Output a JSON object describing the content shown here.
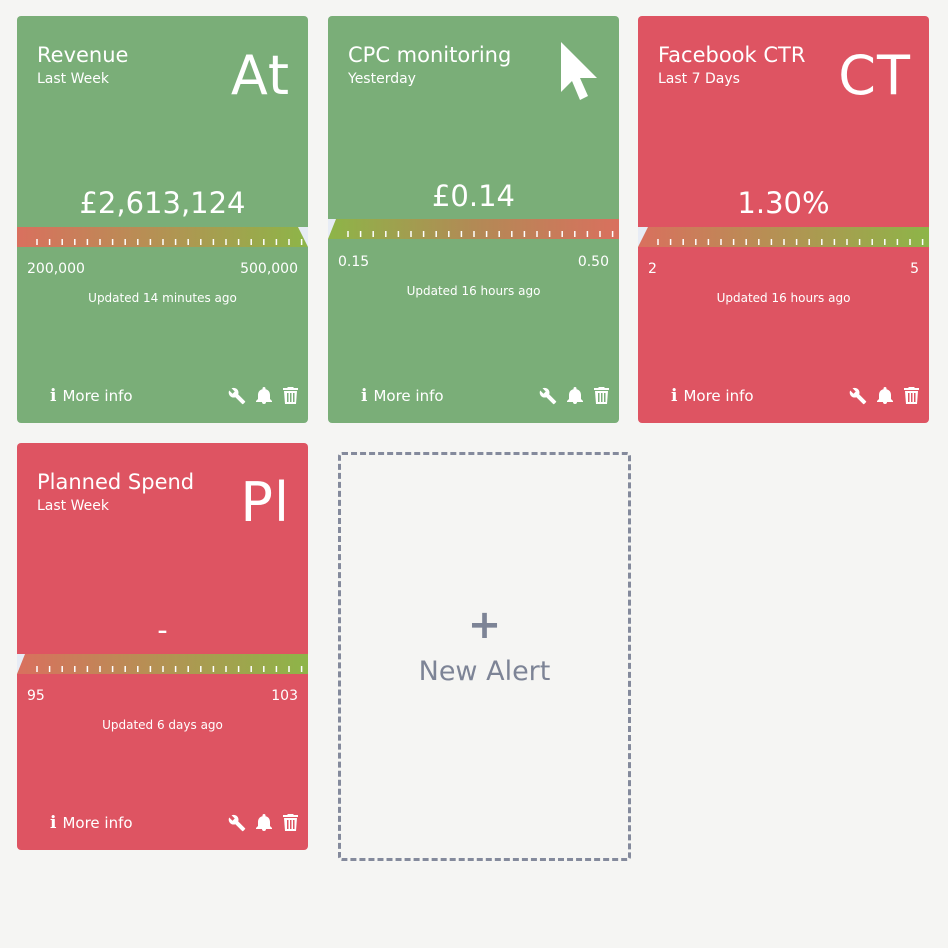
{
  "cards": [
    {
      "title": "Revenue",
      "period": "Last Week",
      "abbr": "At",
      "icon": "",
      "value": "£2,613,124",
      "min": "200,000",
      "max": "500,000",
      "updated": "Updated 14 minutes ago",
      "more_info": "More info",
      "status": "green",
      "marker_position": 1.0
    },
    {
      "title": "CPC monitoring",
      "period": "Yesterday",
      "abbr": "",
      "icon": "cursor-icon",
      "value": "£0.14",
      "min": "0.15",
      "max": "0.50",
      "updated": "Updated 16 hours ago",
      "more_info": "More info",
      "status": "green",
      "marker_position": 0.0
    },
    {
      "title": "Facebook CTR",
      "period": "Last 7 Days",
      "abbr": "CT",
      "icon": "",
      "value": "1.30%",
      "min": "2",
      "max": "5",
      "updated": "Updated 16 hours ago",
      "more_info": "More info",
      "status": "red",
      "marker_position": 0.0
    },
    {
      "title": "Planned Spend",
      "period": "Last Week",
      "abbr": "Pl",
      "icon": "",
      "value": "-",
      "min": "95",
      "max": "103",
      "updated": "Updated 6 days ago",
      "more_info": "More info",
      "status": "red",
      "marker_position": 0.0
    }
  ],
  "new_alert": {
    "plus": "+",
    "label": "New Alert"
  },
  "colors": {
    "green": "#7aae78",
    "red": "#de5462",
    "gauge_start": "#d9705e",
    "gauge_end": "#8db548",
    "dashed_border": "#848a9c"
  },
  "icons": [
    "info-icon",
    "wrench-icon",
    "bell-icon",
    "trash-icon",
    "cursor-icon",
    "plus-icon"
  ]
}
